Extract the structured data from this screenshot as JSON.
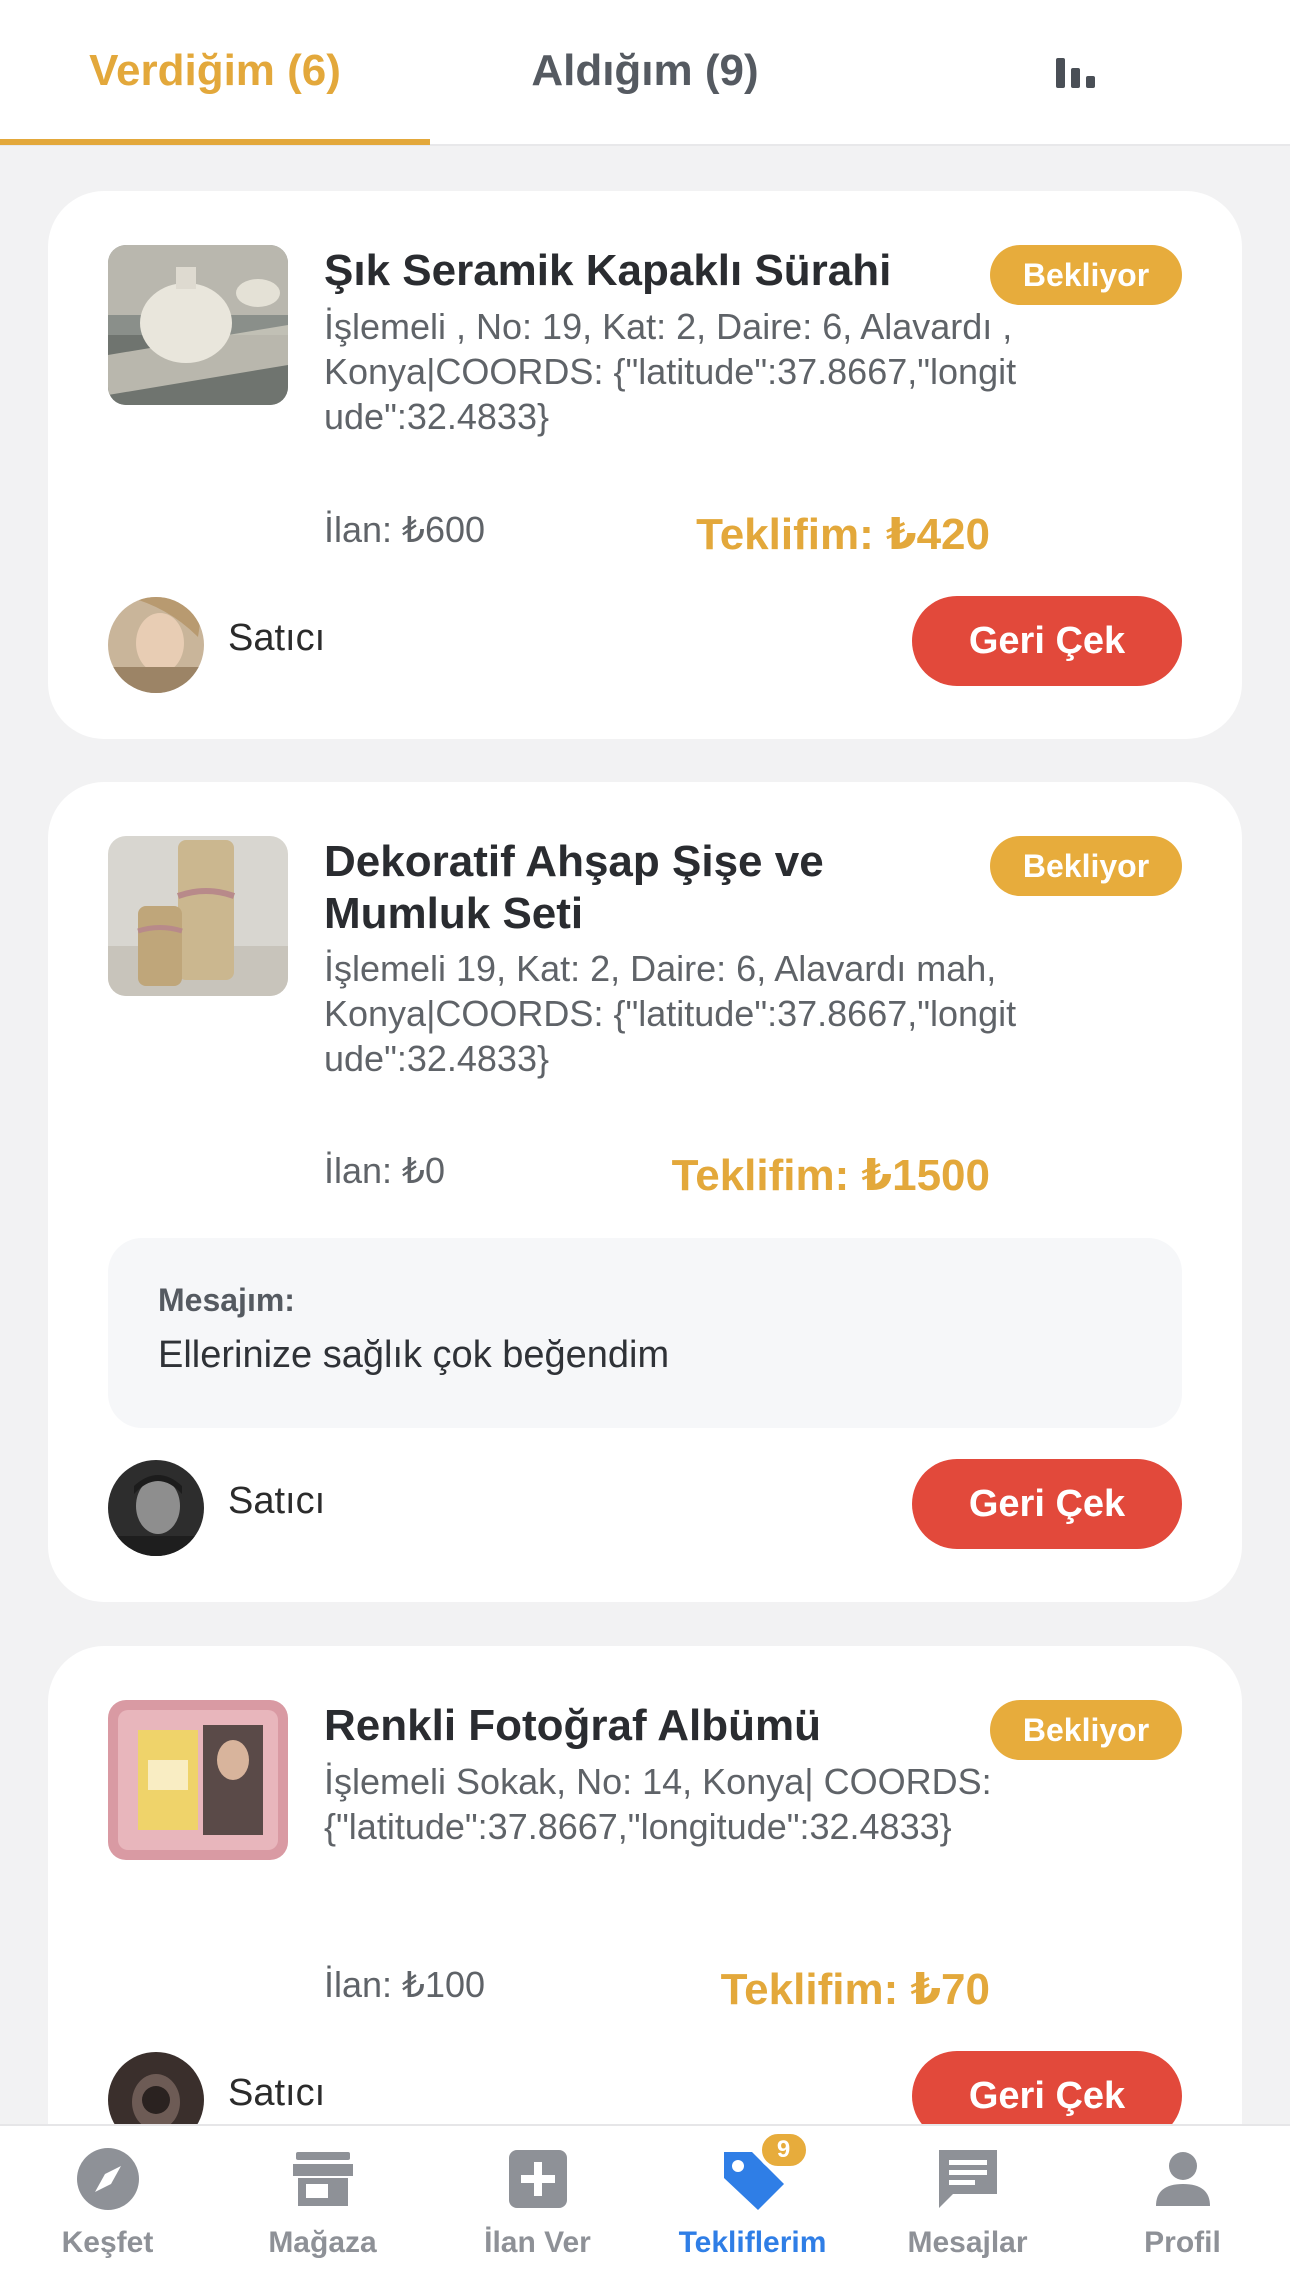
{
  "tabs": {
    "given": "Verdiğim (6)",
    "received": "Aldığım (9)",
    "stats_icon": "bar-chart-icon"
  },
  "offers": [
    {
      "title": "Şık Seramik Kapaklı Sürahi",
      "status": "Bekliyor",
      "address": "İşlemeli , No: 19, Kat: 2, Daire: 6, Alavardı , Konya|COORDS: {\"latitude\":37.8667,\"longitude\":32.4833}",
      "listing_price": "İlan: ₺600",
      "my_offer": "Teklifim: ₺420",
      "seller": "Satıcı",
      "withdraw": "Geri Çek"
    },
    {
      "title": "Dekoratif Ahşap Şişe ve Mumluk Seti",
      "status": "Bekliyor",
      "address": "İşlemeli 19, Kat: 2, Daire: 6, Alavardı mah, Konya|COORDS: {\"latitude\":37.8667,\"longitude\":32.4833}",
      "listing_price": "İlan: ₺0",
      "my_offer": "Teklifim: ₺1500",
      "message_label": "Mesajım:",
      "message": "Ellerinize sağlık çok beğendim",
      "seller": "Satıcı",
      "withdraw": "Geri Çek"
    },
    {
      "title": "Renkli Fotoğraf Albümü",
      "status": "Bekliyor",
      "address": "İşlemeli Sokak, No: 14, Konya| COORDS: {\"latitude\":37.8667,\"longitude\":32.4833}",
      "listing_price": "İlan: ₺100",
      "my_offer": "Teklifim: ₺70",
      "seller": "Satıcı",
      "withdraw": "Geri Çek"
    }
  ],
  "nav": {
    "explore": "Keşfet",
    "store": "Mağaza",
    "post": "İlan Ver",
    "offers": "Tekliflerim",
    "offers_badge": "9",
    "messages": "Mesajlar",
    "profile": "Profil"
  },
  "colors": {
    "accent": "#e3a83b",
    "danger": "#e2493b",
    "active_nav": "#2f7ee6"
  }
}
